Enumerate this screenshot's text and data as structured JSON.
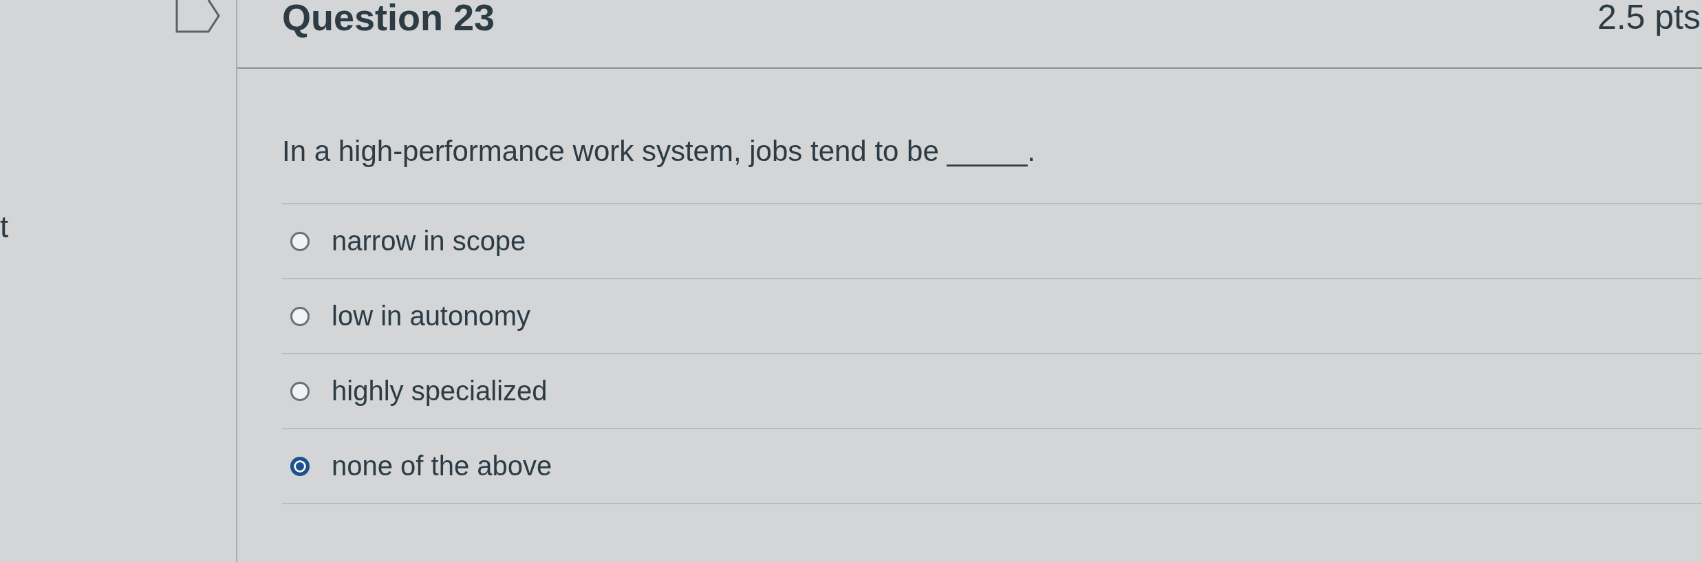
{
  "sidebar": {
    "cut_text": "t"
  },
  "question": {
    "title": "Question 23",
    "points": "2.5 pts",
    "prompt": "In a high-performance work system, jobs tend to be _____."
  },
  "answers": [
    {
      "label": "narrow in scope",
      "selected": false
    },
    {
      "label": "low in autonomy",
      "selected": false
    },
    {
      "label": "highly specialized",
      "selected": false
    },
    {
      "label": "none of the above",
      "selected": true
    }
  ]
}
